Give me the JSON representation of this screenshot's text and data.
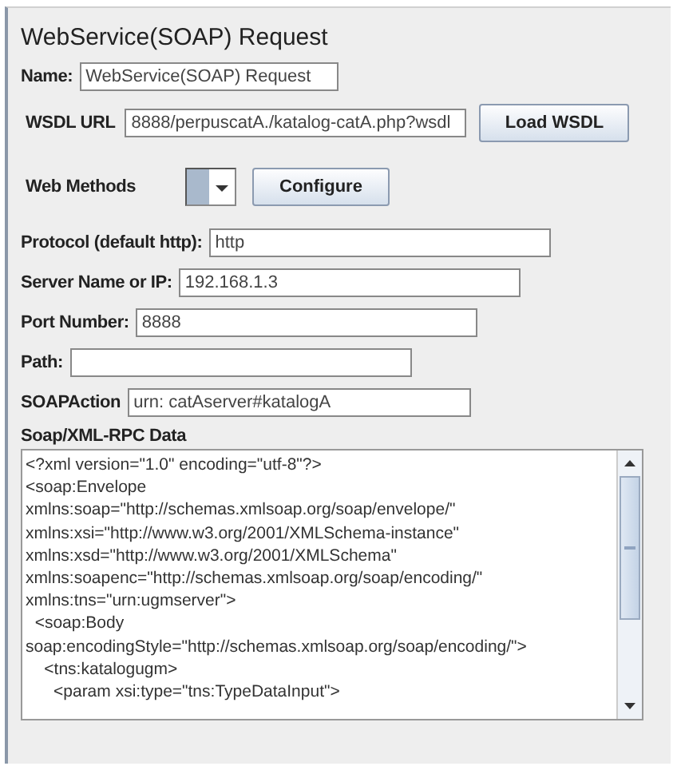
{
  "title": "WebService(SOAP) Request",
  "name_field": {
    "label": "Name:",
    "value": "WebService(SOAP) Request"
  },
  "wsdl": {
    "label": "WSDL URL",
    "value": "8888/perpuscatA./katalog-catA.php?wsdl",
    "button": "Load WSDL"
  },
  "web_methods": {
    "label": "Web Methods",
    "button": "Configure"
  },
  "fields": [
    {
      "label": "Protocol (default http):",
      "value": "http"
    },
    {
      "label": "Server Name or IP:",
      "value": "192.168.1.3"
    },
    {
      "label": "Port Number:",
      "value": "8888"
    },
    {
      "label": "Path:"
    },
    {
      "label": "SOAPAction",
      "value": "urn: catAserver#katalogA"
    }
  ],
  "data": {
    "label": "Soap/XML-RPC Data",
    "lines": [
      "<?xml version=\"1.0\" encoding=\"utf-8\"?>",
      "<soap:Envelope",
      "xmlns:soap=\"http://schemas.xmlsoap.org/soap/envelope/\"",
      "xmlns:xsi=\"http://www.w3.org/2001/XMLSchema-instance\"",
      "xmlns:xsd=\"http://www.w3.org/2001/XMLSchema\"",
      "xmlns:soapenc=\"http://schemas.xmlsoap.org/soap/encoding/\"",
      "xmlns:tns=\"urn:ugmserver\">",
      "  <soap:Body",
      "soap:encodingStyle=\"http://schemas.xmlsoap.org/soap/encoding/\">",
      "    <tns:katalogugm>",
      "      <param xsi:type=\"tns:TypeDataInput\">"
    ]
  }
}
